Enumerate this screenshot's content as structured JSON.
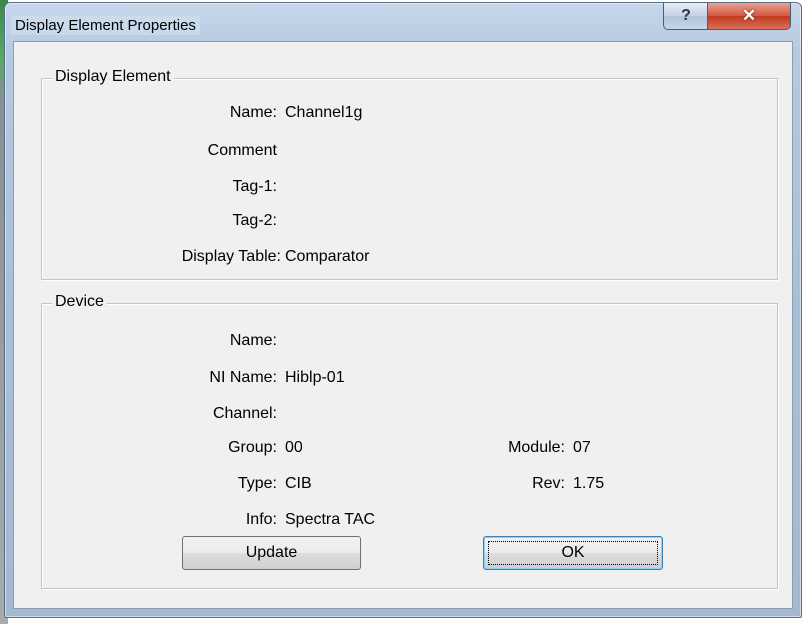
{
  "window": {
    "title": "Display Element Properties",
    "help_glyph": "?",
    "close_glyph": "✕"
  },
  "display_element": {
    "legend": "Display Element",
    "name_label": "Name:",
    "name_value": "Channel1g",
    "comment_label": "Comment",
    "comment_value": "",
    "tag1_label": "Tag-1:",
    "tag1_value": "",
    "tag2_label": "Tag-2:",
    "tag2_value": "",
    "display_table_label": "Display Table:",
    "display_table_value": "Comparator"
  },
  "device": {
    "legend": "Device",
    "name_label": "Name:",
    "name_value": "",
    "ni_name_label": "NI Name:",
    "ni_name_value": "Hiblp-01",
    "channel_label": "Channel:",
    "channel_value": "",
    "group_label": "Group:",
    "group_value": "00",
    "module_label": "Module:",
    "module_value": "07",
    "type_label": "Type:",
    "type_value": "CIB",
    "rev_label": "Rev:",
    "rev_value": "1.75",
    "info_label": "Info:",
    "info_value": "Spectra TAC"
  },
  "buttons": {
    "update_label": "Update",
    "ok_label": "OK"
  }
}
